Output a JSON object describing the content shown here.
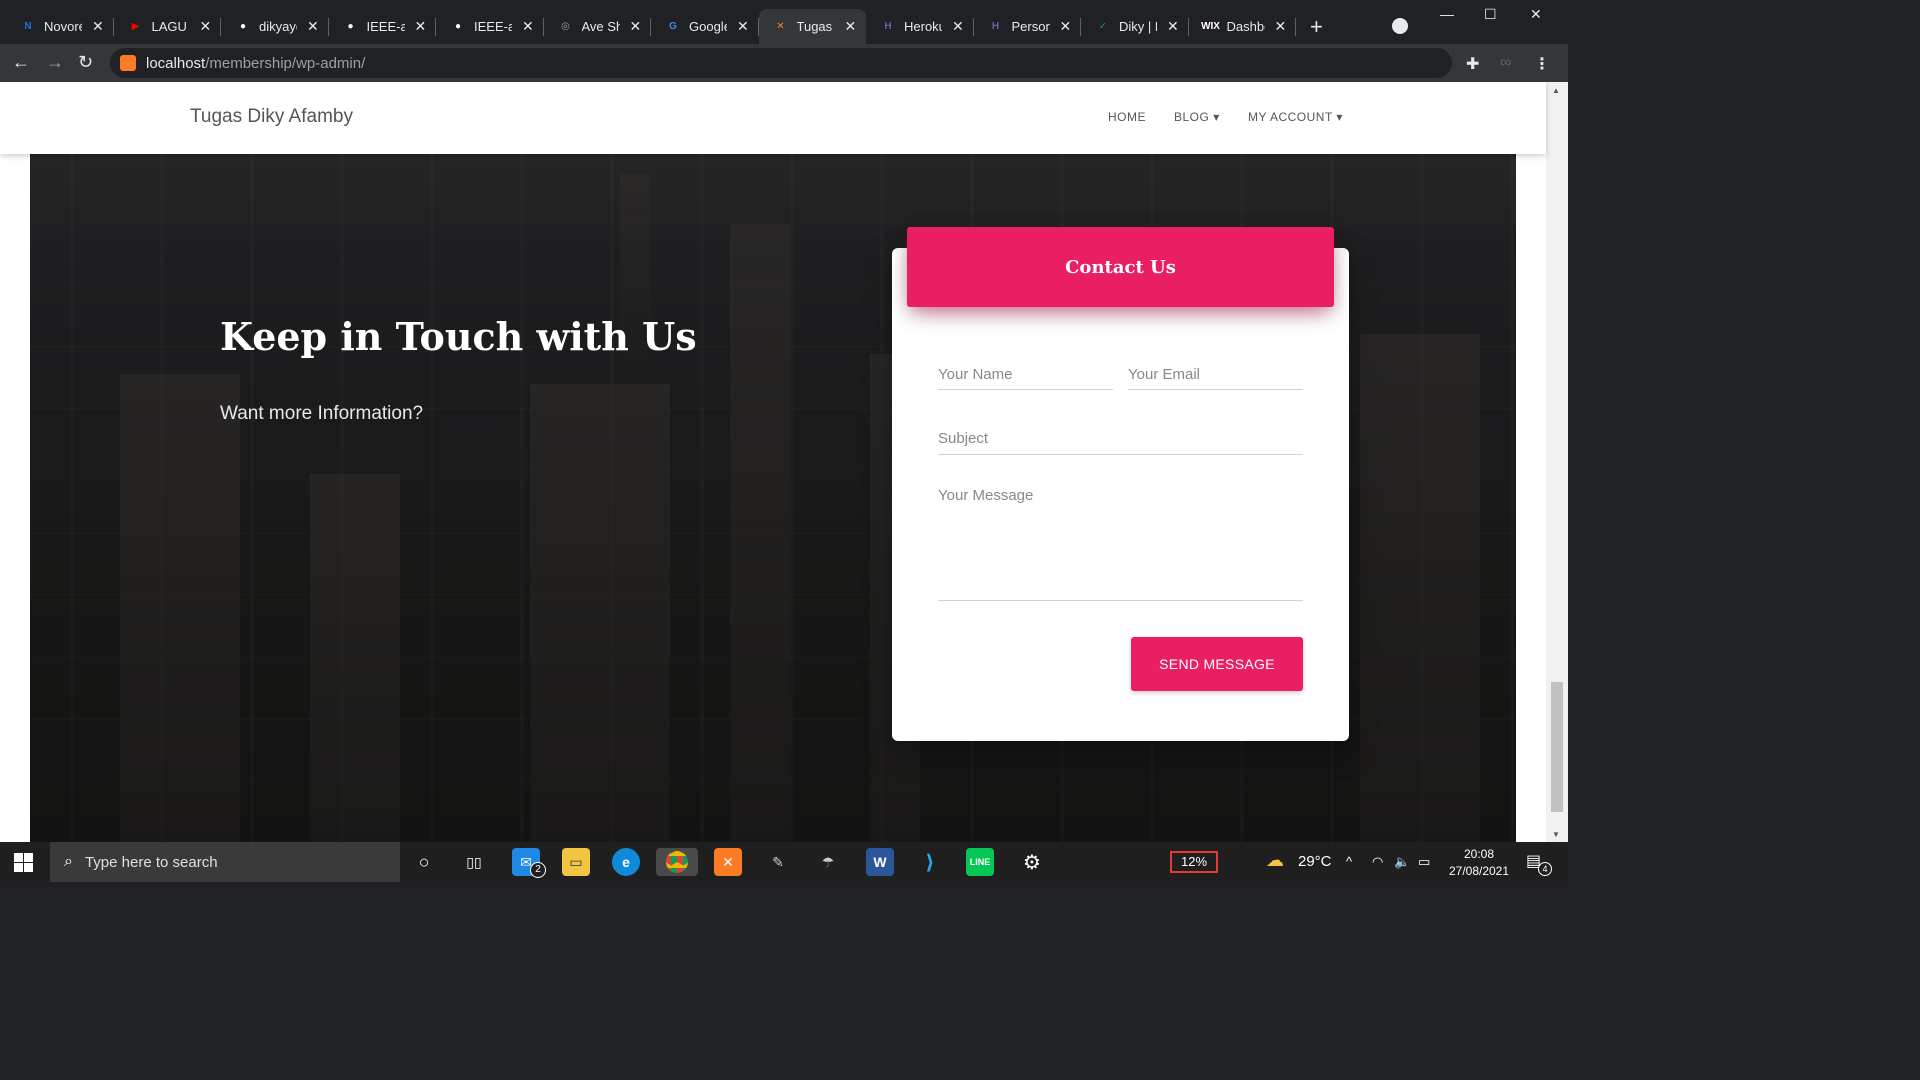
{
  "browser": {
    "tabs": [
      {
        "label": "Novoré",
        "icon": "N",
        "color": "#1f6feb"
      },
      {
        "label": "LAGU S",
        "icon": "▶",
        "color": "#ff0000"
      },
      {
        "label": "dikyayo",
        "icon": "●",
        "color": "#ffffff"
      },
      {
        "label": "IEEE-aw",
        "icon": "●",
        "color": "#ffffff"
      },
      {
        "label": "IEEE-aw",
        "icon": "●",
        "color": "#ffffff"
      },
      {
        "label": "Ave Shi",
        "icon": "◎",
        "color": "#9aa0a6"
      },
      {
        "label": "Google",
        "icon": "G",
        "color": "#4285f4"
      },
      {
        "label": "Tugas D",
        "icon": "✕",
        "color": "#fb7a24",
        "active": true
      },
      {
        "label": "Heroku",
        "icon": "H",
        "color": "#6762a6"
      },
      {
        "label": "Persona",
        "icon": "H",
        "color": "#6762a6"
      },
      {
        "label": "Diky | P",
        "icon": "✓",
        "color": "#0f9d58"
      },
      {
        "label": "Dashbo",
        "icon": "WIX",
        "color": "#ffffff"
      }
    ],
    "url_host": "localhost",
    "url_path": "/membership/wp-admin/"
  },
  "site": {
    "brand": "Tugas Diky Afamby",
    "nav": {
      "home": "HOME",
      "blog": "BLOG",
      "account": "MY ACCOUNT"
    }
  },
  "hero": {
    "title": "Keep in Touch with Us",
    "subtitle": "Want more Information?"
  },
  "contact": {
    "title": "Contact Us",
    "name_placeholder": "Your Name",
    "email_placeholder": "Your Email",
    "subject_placeholder": "Subject",
    "message_placeholder": "Your Message",
    "send_label": "SEND MESSAGE"
  },
  "taskbar": {
    "search_placeholder": "Type here to search",
    "mail_badge": "2",
    "battery": "12%",
    "temperature": "29°C",
    "time": "20:08",
    "date": "27/08/2021",
    "notifications": "4"
  }
}
